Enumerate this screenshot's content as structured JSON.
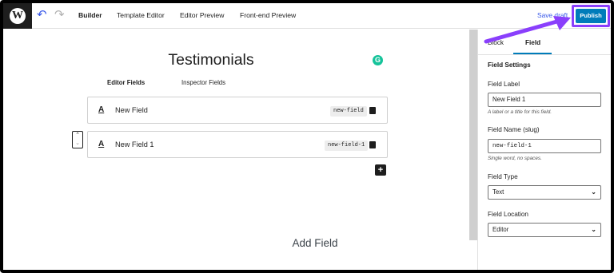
{
  "topbar": {
    "nav": [
      {
        "label": "Builder",
        "active": true
      },
      {
        "label": "Template Editor",
        "active": false
      },
      {
        "label": "Editor Preview",
        "active": false
      },
      {
        "label": "Front-end Preview",
        "active": false
      }
    ],
    "save_draft_label": "Save draft",
    "publish_label": "Publish",
    "highlight_color": "#8a3ffc",
    "accent_color": "#007cba"
  },
  "canvas": {
    "title": "Testimonials",
    "tabs": [
      {
        "label": "Editor Fields",
        "active": true
      },
      {
        "label": "Inspector Fields",
        "active": false
      }
    ],
    "fields": [
      {
        "label": "New Field",
        "slug": "new-field"
      },
      {
        "label": "New Field 1",
        "slug": "new-field-1"
      }
    ],
    "add_field_label": "Add Field"
  },
  "sidebar": {
    "tabs": [
      {
        "label": "Block",
        "active": false
      },
      {
        "label": "Field",
        "active": true
      }
    ],
    "heading": "Field Settings",
    "field_label": {
      "label": "Field Label",
      "value": "New Field 1",
      "help": "A label or a title for this field."
    },
    "field_name": {
      "label": "Field Name (slug)",
      "value": "new-field-1",
      "help": "Single word, no spaces."
    },
    "field_type": {
      "label": "Field Type",
      "value": "Text"
    },
    "field_location": {
      "label": "Field Location",
      "value": "Editor"
    }
  }
}
